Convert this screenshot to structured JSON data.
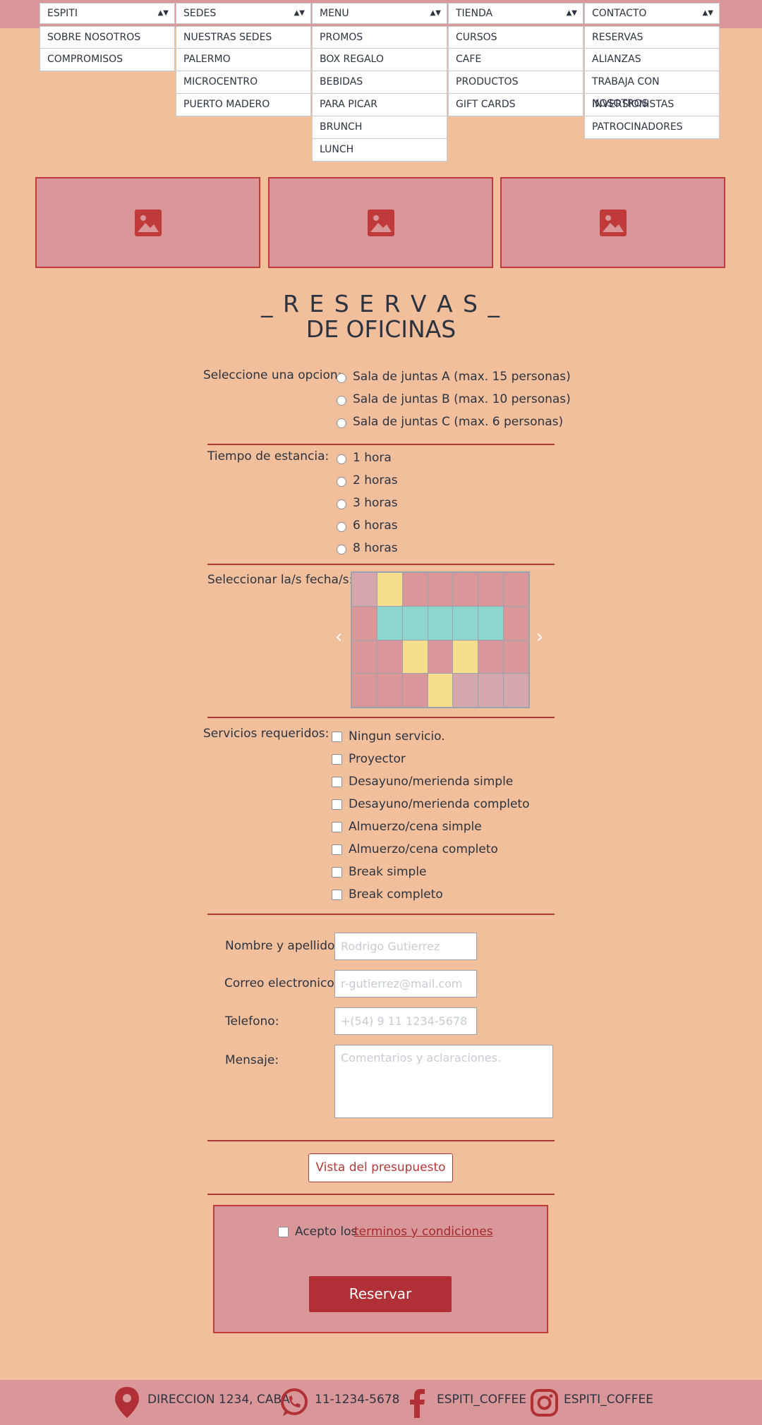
{
  "nav": [
    {
      "label": "ESPITI",
      "items": [
        "SOBRE NOSOTROS",
        "COMPROMISOS"
      ]
    },
    {
      "label": "SEDES",
      "items": [
        "NUESTRAS SEDES",
        "PALERMO",
        "MICROCENTRO",
        "PUERTO MADERO"
      ]
    },
    {
      "label": "MENU",
      "items": [
        "PROMOS",
        "BOX REGALO",
        "BEBIDAS",
        "PARA PICAR",
        "BRUNCH",
        "LUNCH"
      ]
    },
    {
      "label": "TIENDA",
      "items": [
        "CURSOS",
        "CAFE",
        "PRODUCTOS",
        "GIFT CARDS"
      ]
    },
    {
      "label": "CONTACTO",
      "items": [
        "RESERVAS",
        "ALIANZAS",
        "TRABAJA CON NOSOTROS",
        "INVERSIONISTAS",
        "PATROCINADORES"
      ]
    }
  ],
  "heading": {
    "line1": "_ R E S E R V A S _",
    "line2": "DE OFICINAS"
  },
  "room": {
    "label": "Seleccione una opcion:",
    "options": [
      "Sala de juntas A (max. 15 personas)",
      "Sala de juntas B (max. 10 personas)",
      "Sala de juntas C (max. 6 personas)"
    ]
  },
  "duration": {
    "label": "Tiempo de estancia:",
    "options": [
      "1 hora",
      "2 horas",
      "3 horas",
      "6 horas",
      "8 horas"
    ]
  },
  "dates": {
    "label": "Seleccionar la/s fecha/s:",
    "prev": "‹",
    "next": "›",
    "colors": {
      "free": "#d9979a",
      "past": "#d3a7ac",
      "selected": "#f7de8c",
      "range": "#8cd6cd"
    },
    "grid": [
      [
        "past",
        "selected",
        "free",
        "free",
        "free",
        "free",
        "free"
      ],
      [
        "free",
        "range",
        "range",
        "range",
        "range",
        "range",
        "free"
      ],
      [
        "free",
        "free",
        "selected",
        "free",
        "selected",
        "free",
        "free"
      ],
      [
        "free",
        "free",
        "free",
        "selected",
        "past",
        "past",
        "past"
      ]
    ]
  },
  "services": {
    "label": "Servicios requeridos:",
    "options": [
      "Ningun servicio.",
      "Proyector",
      "Desayuno/merienda simple",
      "Desayuno/merienda completo",
      "Almuerzo/cena simple",
      "Almuerzo/cena completo",
      "Break simple",
      "Break completo"
    ]
  },
  "contact": {
    "name_label": "Nombre y apellido:",
    "name_placeholder": "Rodrigo Gutierrez",
    "email_label": "Correo electronico:",
    "email_placeholder": "r-gutierrez@mail.com",
    "phone_label": "Telefono:",
    "phone_placeholder": "+(54) 9 11 1234-5678",
    "message_label": "Mensaje:",
    "message_placeholder": "Comentarios y aclaraciones."
  },
  "preview_button": "Vista del presupuesto",
  "terms": {
    "prefix": "Acepto los",
    "link": "terminos y condiciones"
  },
  "submit_button": "Reservar",
  "footer": {
    "address": "DIRECCION 1234, CABA",
    "phone": "11-1234-5678",
    "facebook": "ESPITI_COFFEE",
    "instagram": "ESPITI_COFFEE"
  },
  "theme": {
    "accent": "#b03035",
    "page_bg": "#f2bf9c",
    "panel_bg": "#d9979a"
  }
}
